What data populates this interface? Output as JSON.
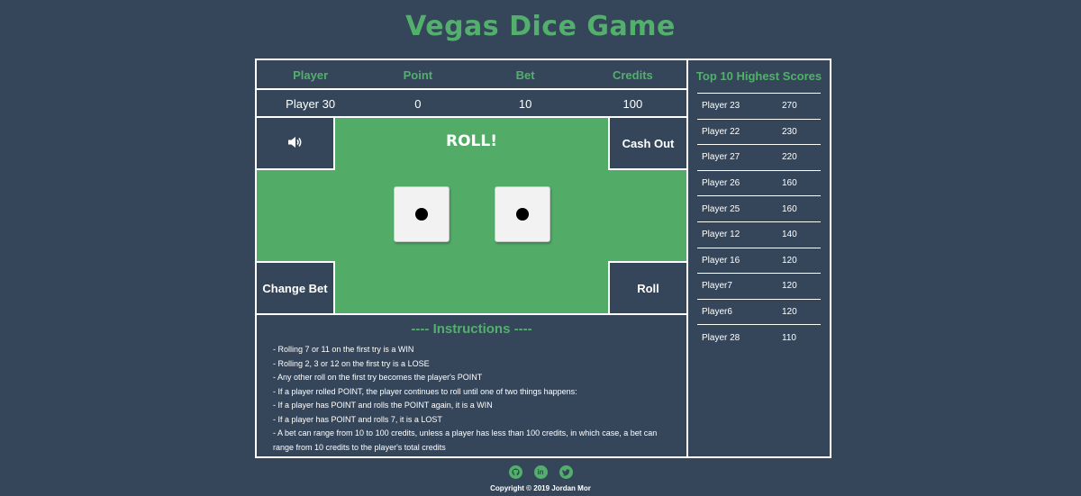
{
  "title": "Vegas Dice Game",
  "colors": {
    "background": "#35465a",
    "accent": "#52b06c",
    "table": "#52ac68"
  },
  "header": {
    "player": "Player",
    "point": "Point",
    "bet": "Bet",
    "credits": "Credits"
  },
  "stats": {
    "player": "Player 30",
    "point": "0",
    "bet": "10",
    "credits": "100"
  },
  "table": {
    "roll_banner": "ROLL!",
    "sound_icon": "speaker-icon",
    "cash_out_label": "Cash Out",
    "change_bet_label": "Change Bet",
    "roll_label": "Roll",
    "dice": [
      1,
      1
    ]
  },
  "instructions": {
    "title": "---- Instructions ----",
    "items": [
      "- Rolling 7 or 11 on the first try is a WIN",
      "- Rolling 2, 3 or 12 on the first try is a LOSE",
      "- Any other roll on the first try becomes the player's POINT",
      "- If a player rolled POINT, the player continues to roll until one of two things happens:",
      "- If a player has POINT and rolls the POINT again, it is a WIN",
      "- If a player has POINT and rolls 7, it is a LOST",
      "- A bet can range from 10 to 100 credits, unless a player has less than 100 credits, in which case, a bet can range from 10 credits to the player's total credits"
    ]
  },
  "scores": {
    "title": "Top 10 Highest Scores",
    "rows": [
      {
        "name": "Player 23",
        "score": "270"
      },
      {
        "name": "Player 22",
        "score": "230"
      },
      {
        "name": "Player 27",
        "score": "220"
      },
      {
        "name": "Player 26",
        "score": "160"
      },
      {
        "name": "Player 25",
        "score": "160"
      },
      {
        "name": "Player 12",
        "score": "140"
      },
      {
        "name": "Player 16",
        "score": "120"
      },
      {
        "name": "Player7",
        "score": "120"
      },
      {
        "name": "Player6",
        "score": "120"
      },
      {
        "name": "Player 28",
        "score": "110"
      }
    ]
  },
  "footer": {
    "icons": [
      "github-icon",
      "linkedin-icon",
      "twitter-icon"
    ],
    "copyright": "Copyright © 2019 Jordan Mor"
  }
}
